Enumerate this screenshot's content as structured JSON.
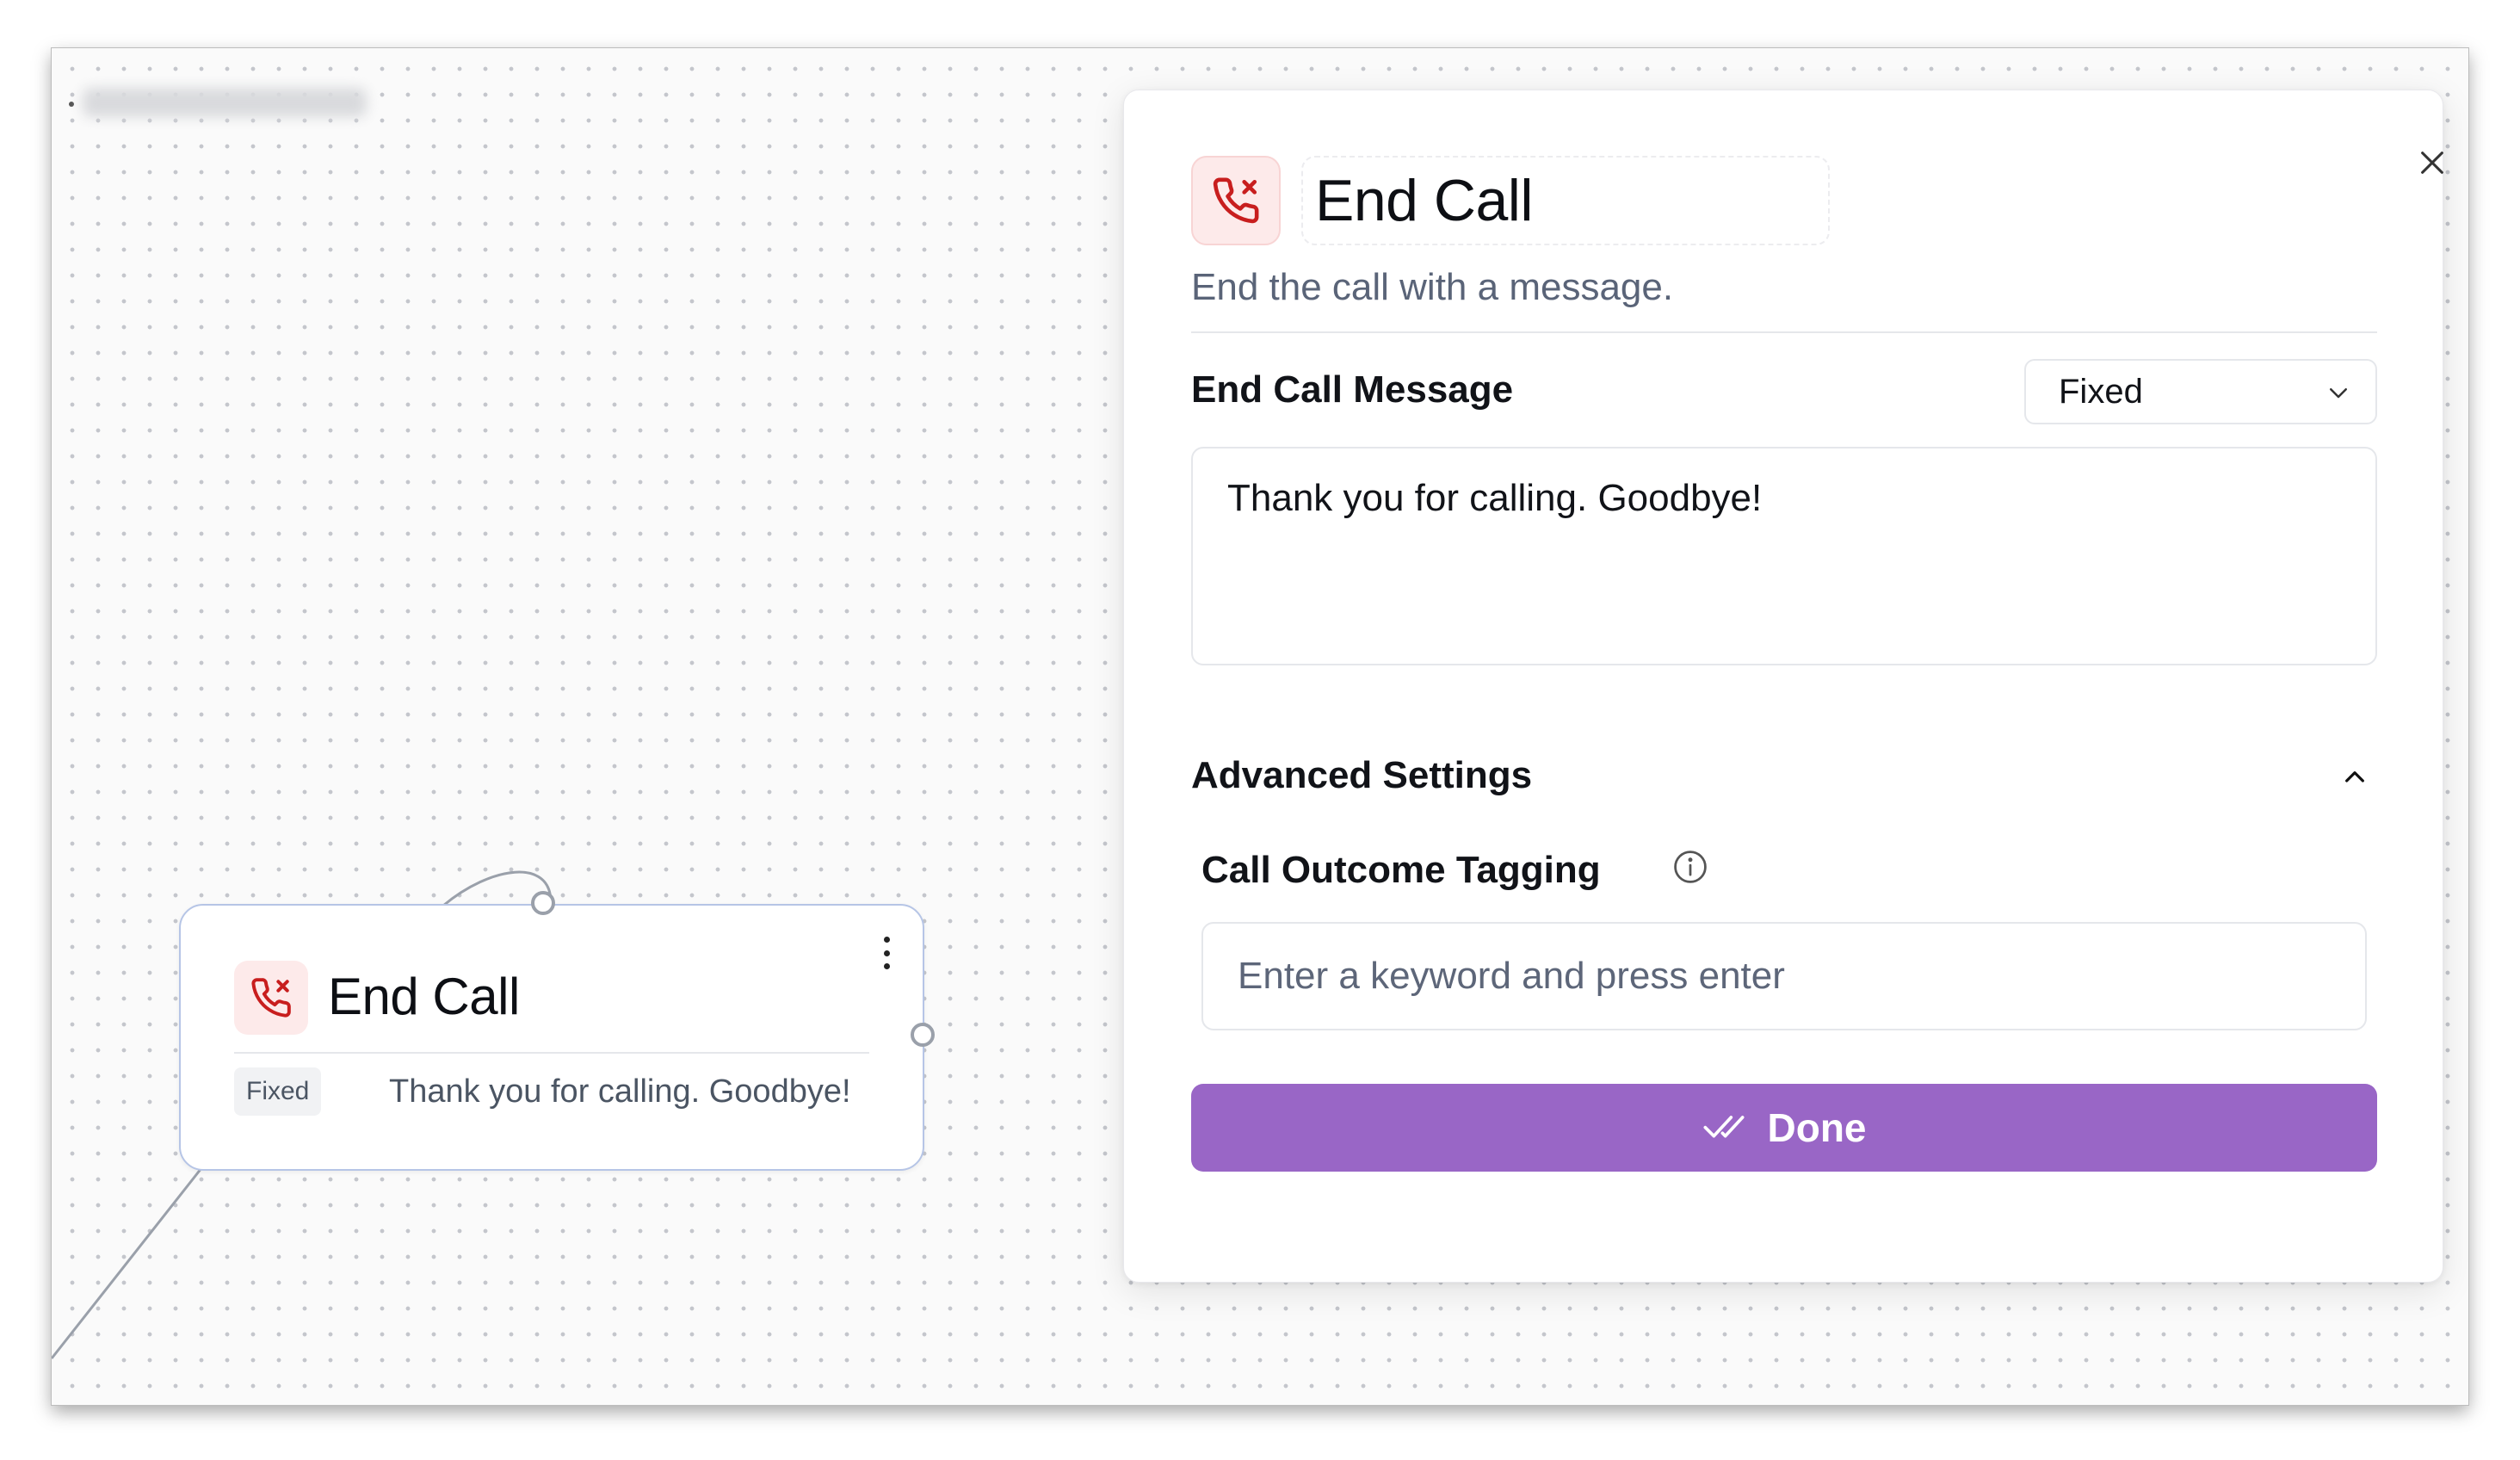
{
  "canvas": {
    "node": {
      "title": "End Call",
      "badge": "Fixed",
      "message": "Thank you for calling. Goodbye!",
      "icon": "phone-end-icon"
    }
  },
  "panel": {
    "title": "End Call",
    "subtitle": "End the call with a message.",
    "message_label": "End Call Message",
    "message_type": {
      "selected": "Fixed",
      "options": [
        "Fixed"
      ]
    },
    "message_value": "Thank you for calling. Goodbye!",
    "advanced_label": "Advanced Settings",
    "advanced_expanded": true,
    "outcome_label": "Call Outcome Tagging",
    "outcome_placeholder": "Enter a keyword and press enter",
    "done_label": "Done"
  },
  "colors": {
    "accent": "#9966c6",
    "icon_red": "#c81e1e",
    "icon_bg": "#fdeaea",
    "node_border": "#b6c5e6"
  }
}
